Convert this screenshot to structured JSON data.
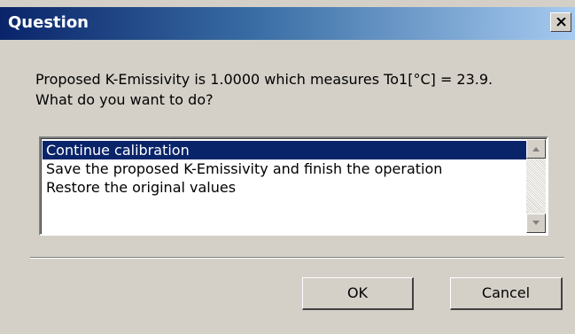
{
  "dialog": {
    "title": "Question",
    "close_icon": "close-icon",
    "message_line1": "Proposed K-Emissivity is 1.0000 which measures To1[°C] = 23.9.",
    "message_line2": "What do you want to do?",
    "options": [
      "Continue calibration",
      "Save the proposed K-Emissivity and finish the operation",
      "Restore the original values"
    ],
    "selected_index": 0,
    "ok_label": "OK",
    "cancel_label": "Cancel"
  },
  "colors": {
    "titlebar_start": "#0a246a",
    "titlebar_end": "#a6caf0",
    "selection": "#0a246a",
    "face": "#d4d0c8"
  }
}
